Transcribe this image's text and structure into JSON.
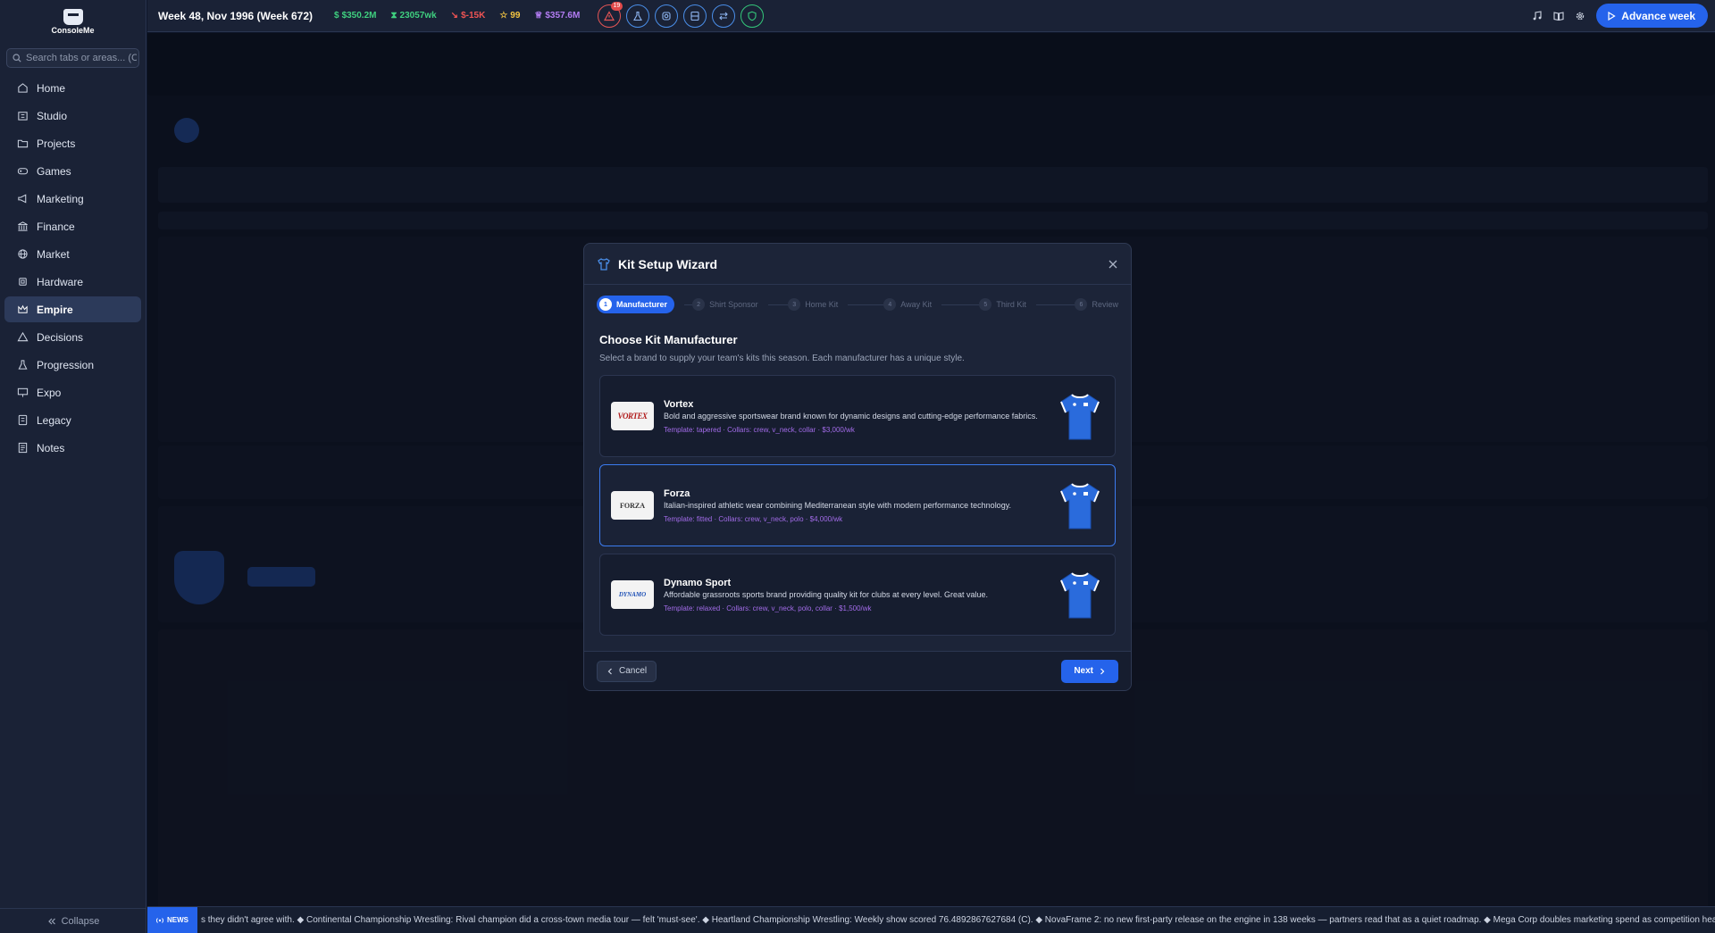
{
  "app": {
    "logo_text": "ConsoleMe"
  },
  "sidebar": {
    "search_placeholder": "Search tabs or areas... (Ctrl+K)",
    "items": [
      {
        "label": "Home",
        "icon": "home-icon",
        "active": false
      },
      {
        "label": "Studio",
        "icon": "building-icon",
        "active": false
      },
      {
        "label": "Projects",
        "icon": "folder-icon",
        "active": false
      },
      {
        "label": "Games",
        "icon": "gamepad-icon",
        "active": false
      },
      {
        "label": "Marketing",
        "icon": "megaphone-icon",
        "active": false
      },
      {
        "label": "Finance",
        "icon": "bank-icon",
        "active": false
      },
      {
        "label": "Market",
        "icon": "globe-icon",
        "active": false
      },
      {
        "label": "Hardware",
        "icon": "chip-icon",
        "active": false
      },
      {
        "label": "Empire",
        "icon": "crown-icon",
        "active": true
      },
      {
        "label": "Decisions",
        "icon": "warning-icon",
        "active": false
      },
      {
        "label": "Progression",
        "icon": "flask-icon",
        "active": false
      },
      {
        "label": "Expo",
        "icon": "presentation-icon",
        "active": false
      },
      {
        "label": "Legacy",
        "icon": "book-icon",
        "active": false
      },
      {
        "label": "Notes",
        "icon": "notes-icon",
        "active": false
      }
    ],
    "collapse_label": "Collapse"
  },
  "topbar": {
    "week": "Week 48, Nov 1996 (Week 672)",
    "stats": [
      {
        "label": "$350.2M",
        "color": "#3fcf7f",
        "icon": "dollar-icon"
      },
      {
        "label": "23057wk",
        "color": "#3fcf7f",
        "icon": "hourglass-icon"
      },
      {
        "label": "$-15K",
        "color": "#ef5454",
        "icon": "trend-down-icon"
      },
      {
        "label": "99",
        "color": "#f4c542",
        "icon": "star-icon"
      },
      {
        "label": "$357.6M",
        "color": "#b27cf2",
        "icon": "crown-icon"
      }
    ],
    "alert_badge": "19",
    "advance_label": "Advance week"
  },
  "modal": {
    "title": "Kit Setup Wizard",
    "steps": [
      {
        "num": "1",
        "label": "Manufacturer"
      },
      {
        "num": "2",
        "label": "Shirt Sponsor"
      },
      {
        "num": "3",
        "label": "Home Kit"
      },
      {
        "num": "4",
        "label": "Away Kit"
      },
      {
        "num": "5",
        "label": "Third Kit"
      },
      {
        "num": "6",
        "label": "Review"
      }
    ],
    "heading": "Choose Kit Manufacturer",
    "subheading": "Select a brand to supply your team's kits this season. Each manufacturer has a unique style.",
    "manufacturers": [
      {
        "name": "Vortex",
        "logo": "VORTEX",
        "desc": "Bold and aggressive sportswear brand known for dynamic designs and cutting-edge performance fabrics.",
        "meta": "Template: tapered · Collars: crew, v_neck, collar · $3,000/wk",
        "selected": false
      },
      {
        "name": "Forza",
        "logo": "FORZA",
        "desc": "Italian-inspired athletic wear combining Mediterranean style with modern performance technology.",
        "meta": "Template: fitted · Collars: crew, v_neck, polo · $4,000/wk",
        "selected": true
      },
      {
        "name": "Dynamo Sport",
        "logo": "DYNAMO",
        "desc": "Affordable grassroots sports brand providing quality kit for clubs at every level. Great value.",
        "meta": "Template: relaxed · Collars: crew, v_neck, polo, collar · $1,500/wk",
        "selected": false
      }
    ],
    "cancel_label": "Cancel",
    "next_label": "Next"
  },
  "ticker": {
    "tag": "NEWS",
    "text": "s they didn't agree with. ◆ Continental Championship Wrestling: Rival champion did a cross-town media tour — felt 'must-see'. ◆ Heartland Championship Wrestling: Weekly show scored 76.4892867627684 (C). ◆ NovaFrame 2: no new first-party release on the engine in 138 weeks — partners read that as a quiet roadmap. ◆ Mega Corp doubles marketing spend as competition heats up. ◆"
  },
  "colors": {
    "accent": "#2563eb",
    "shirt": "#2a6bdc"
  }
}
